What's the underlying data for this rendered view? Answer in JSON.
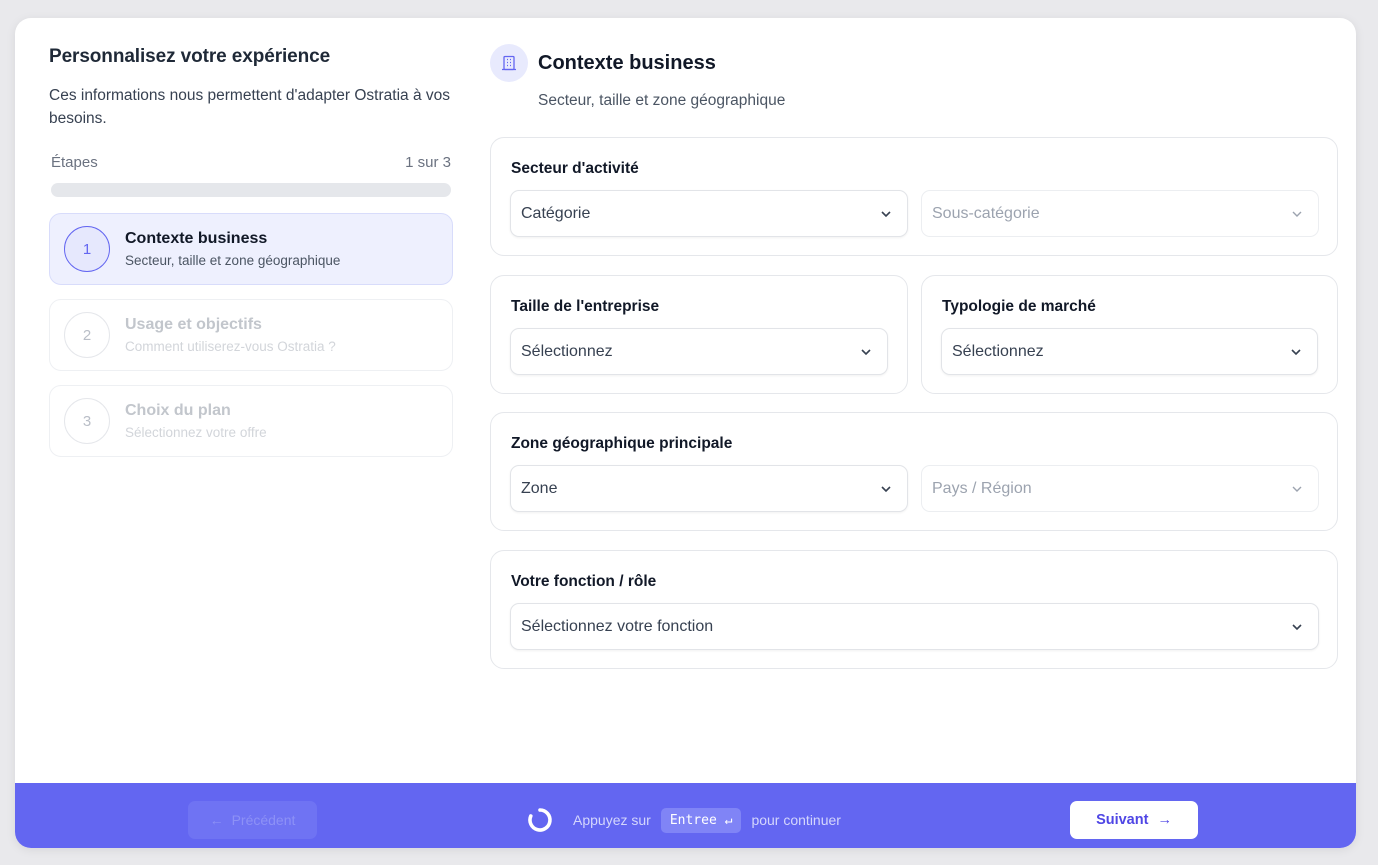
{
  "sidebar": {
    "title": "Personnalisez votre expérience",
    "description": "Ces informations nous permettent d'adapter Ostratia à vos besoins.",
    "steps_label": "Étapes",
    "steps_count": "1 sur 3",
    "progress_fraction": 0,
    "steps": [
      {
        "number": "1",
        "title": "Contexte business",
        "subtitle": "Secteur, taille et zone géographique",
        "active": true
      },
      {
        "number": "2",
        "title": "Usage et objectifs",
        "subtitle": "Comment utiliserez-vous Ostratia ?",
        "active": false
      },
      {
        "number": "3",
        "title": "Choix du plan",
        "subtitle": "Sélectionnez votre offre",
        "active": false
      }
    ]
  },
  "main": {
    "section_icon": "building-icon",
    "title": "Contexte business",
    "subtitle": "Secteur, taille et zone géographique",
    "sector": {
      "label": "Secteur d'activité",
      "category": "Catégorie",
      "subcategory": "Sous-catégorie"
    },
    "company_size": {
      "label": "Taille de l'entreprise",
      "value": "Sélectionnez"
    },
    "market": {
      "label": "Typologie de marché",
      "value": "Sélectionnez"
    },
    "zone": {
      "label": "Zone géographique principale",
      "zone": "Zone",
      "country": "Pays / Région"
    },
    "role": {
      "label": "Votre fonction / rôle",
      "value": "Sélectionnez votre fonction"
    }
  },
  "footer": {
    "prev_label": "Précédent",
    "hint_before": "Appuyez sur",
    "hint_key": "Entree ↵",
    "hint_after": "pour continuer",
    "next_label": "Suivant",
    "colors": {
      "accent": "#6366f1",
      "active_step_bg": "#eef0fe"
    }
  }
}
